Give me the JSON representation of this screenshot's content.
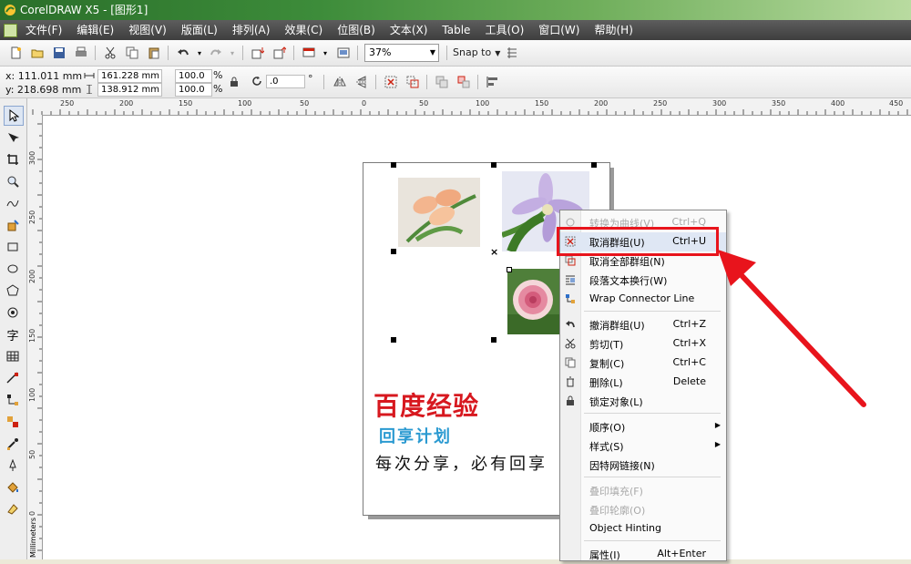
{
  "window": {
    "title": "CorelDRAW X5 - [图形1]"
  },
  "menu": [
    "文件(F)",
    "编辑(E)",
    "视图(V)",
    "版面(L)",
    "排列(A)",
    "效果(C)",
    "位图(B)",
    "文本(X)",
    "Table",
    "工具(O)",
    "窗口(W)",
    "帮助(H)"
  ],
  "toolbar": {
    "zoom": "37%",
    "snap_to": "Snap to"
  },
  "property_bar": {
    "x": "x:  111.011 mm",
    "y": "y:  218.698 mm",
    "width": "161.228 mm",
    "height": "138.912 mm",
    "scale_w": "100.0",
    "scale_h": "100.0",
    "percent": "%",
    "rotation": ".0",
    "degree": "°"
  },
  "ruler": {
    "top_labels": [
      "250",
      "200",
      "150",
      "100",
      "50",
      "0",
      "50",
      "100",
      "150",
      "200",
      "250",
      "300",
      "350",
      "400",
      "450"
    ],
    "left_labels": [
      "300",
      "250",
      "200",
      "150",
      "100",
      "50",
      "0"
    ],
    "units": "Millimeters"
  },
  "page_text": {
    "headline": "百度经验",
    "subhead": "回享计划",
    "tagline": "每次分享，必有回享"
  },
  "context_menu": {
    "items": [
      {
        "label": "转换为曲线(V)",
        "shortcut": "Ctrl+Q",
        "icon": "convert-curve-icon",
        "disabled": true
      },
      {
        "label": "取消群组(U)",
        "shortcut": "Ctrl+U",
        "icon": "ungroup-icon",
        "highlighted": true
      },
      {
        "label": "取消全部群组(N)",
        "shortcut": "",
        "icon": "ungroup-all-icon"
      },
      {
        "label": "段落文本换行(W)",
        "shortcut": "",
        "icon": "text-wrap-icon"
      },
      {
        "label": "Wrap Connector Line",
        "shortcut": "",
        "icon": "connector-icon"
      },
      {
        "label": "撤消群组(U)",
        "shortcut": "Ctrl+Z",
        "icon": "undo-icon"
      },
      {
        "label": "剪切(T)",
        "shortcut": "Ctrl+X",
        "icon": "scissors-icon"
      },
      {
        "label": "复制(C)",
        "shortcut": "Ctrl+C",
        "icon": "copy-icon"
      },
      {
        "label": "删除(L)",
        "shortcut": "Delete",
        "icon": "trash-icon"
      },
      {
        "label": "锁定对象(L)",
        "shortcut": "",
        "icon": "lock-icon"
      },
      {
        "label": "顺序(O)",
        "shortcut": "",
        "submenu": true
      },
      {
        "label": "样式(S)",
        "shortcut": "",
        "submenu": true
      },
      {
        "label": "因特网链接(N)",
        "shortcut": ""
      },
      {
        "label": "叠印填充(F)",
        "shortcut": "",
        "disabled": true
      },
      {
        "label": "叠印轮廓(O)",
        "shortcut": "",
        "disabled": true
      },
      {
        "label": "Object Hinting",
        "shortcut": ""
      },
      {
        "label": "属性(I)",
        "shortcut": "Alt+Enter"
      }
    ]
  },
  "annotation": {
    "highlight_color": "#e8141c"
  }
}
